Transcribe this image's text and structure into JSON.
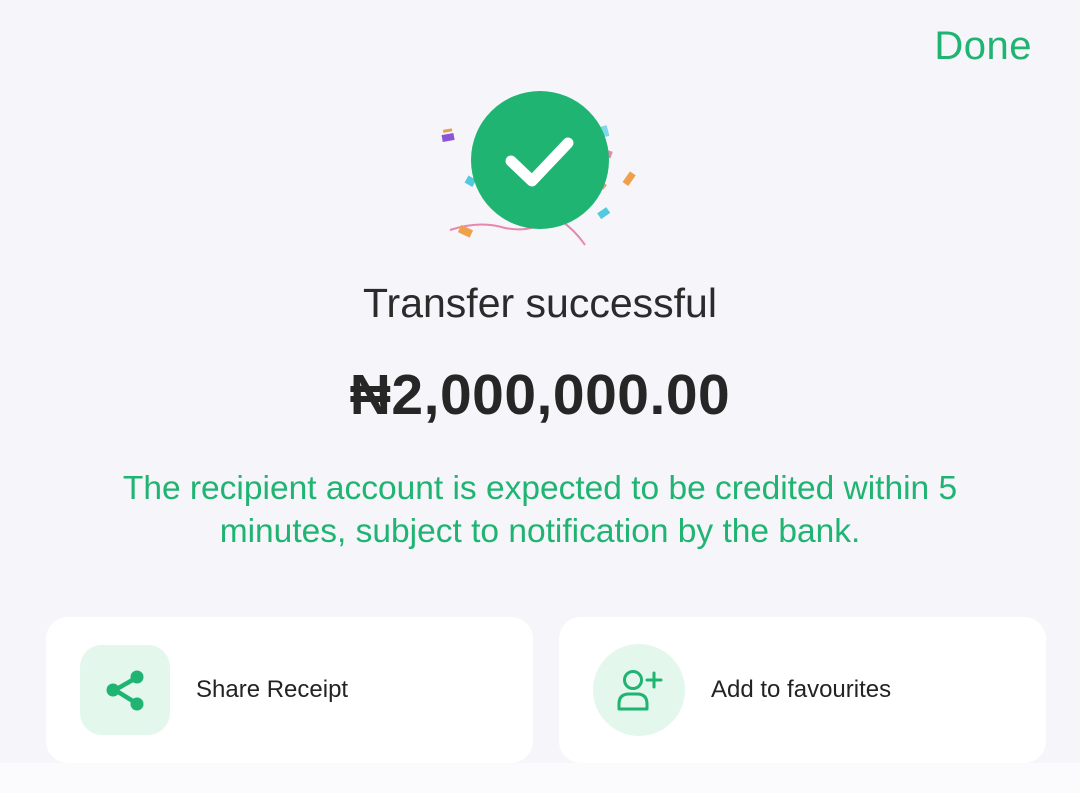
{
  "header": {
    "done_label": "Done"
  },
  "status": {
    "title": "Transfer successful",
    "amount": "₦2,000,000.00",
    "notice": "The recipient account is expected to be credited within 5 minutes, subject to notification by the bank."
  },
  "actions": [
    {
      "label": "Share Receipt",
      "icon": "share-icon"
    },
    {
      "label": "Add to favourites",
      "icon": "add-user-icon"
    }
  ],
  "colors": {
    "accent": "#1fb472",
    "icon_bg": "#e3f7ed",
    "background": "#f5f5fa",
    "card": "#ffffff"
  }
}
